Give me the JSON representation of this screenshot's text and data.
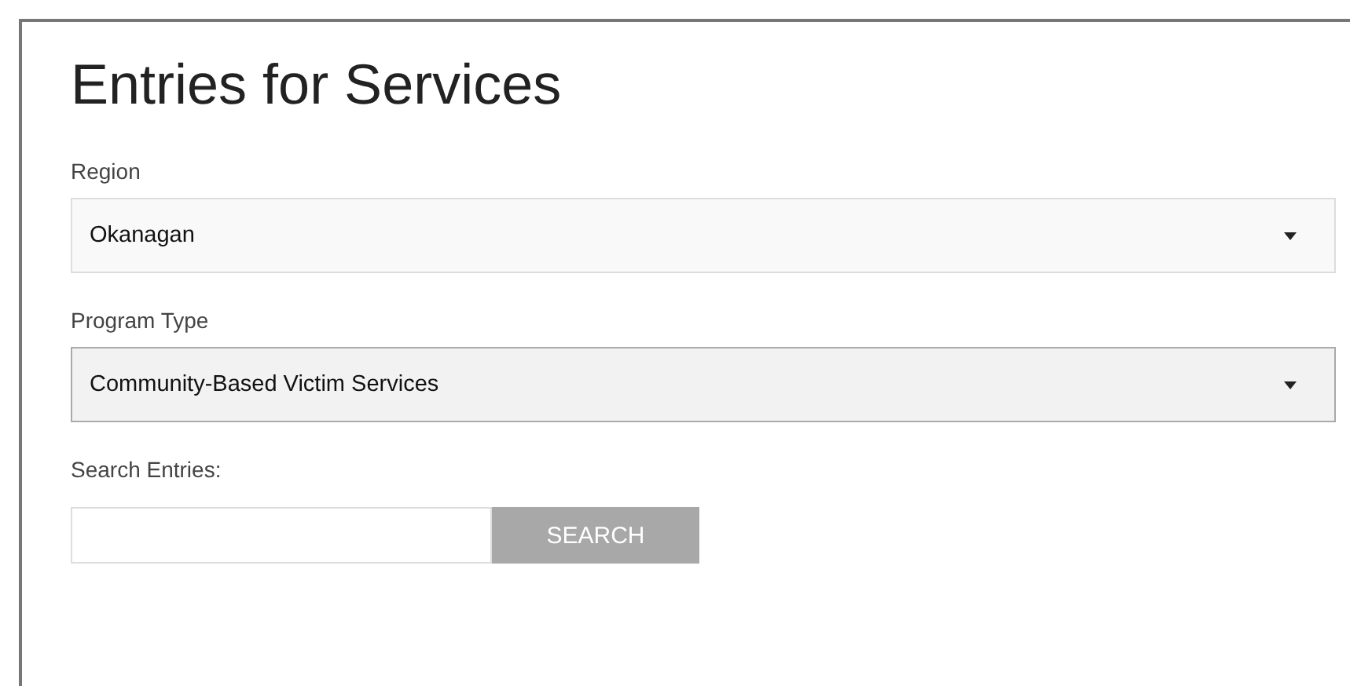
{
  "title": "Entries for Services",
  "selects": [
    {
      "label": "Region",
      "value": "Okanagan",
      "focused": false
    },
    {
      "label": "Program Type",
      "value": "Community-Based Victim Services",
      "focused": true
    }
  ],
  "search": {
    "label": "Search Entries:",
    "button": "SEARCH",
    "button_disabled": true
  }
}
